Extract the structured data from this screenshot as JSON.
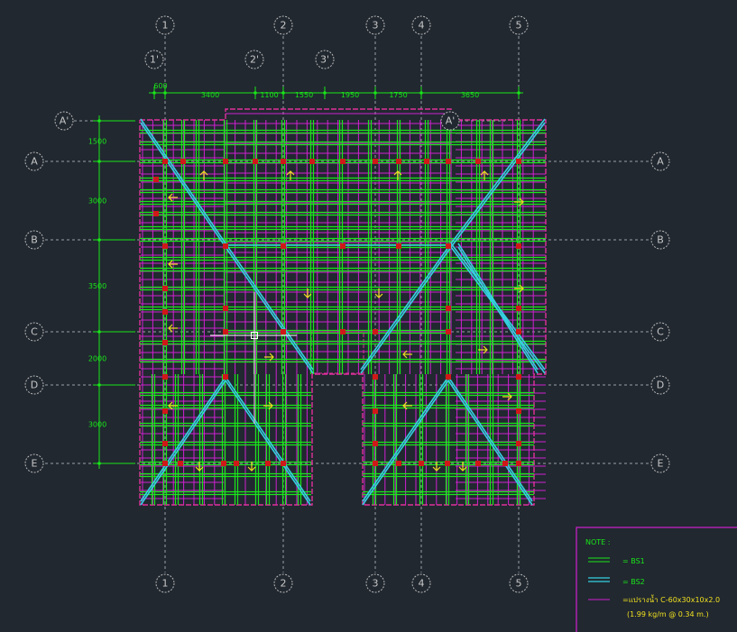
{
  "grid": {
    "columns_main": [
      "1",
      "2",
      "3",
      "4",
      "5"
    ],
    "columns_sub": [
      "1'",
      "2'",
      "3'"
    ],
    "rows": [
      "A",
      "B",
      "C",
      "D",
      "E"
    ],
    "row_sub": "A'"
  },
  "dimensions": {
    "horizontal": [
      "600",
      "3400",
      "1100",
      "1550",
      "1950",
      "1750",
      "3650"
    ],
    "vertical": [
      "1500",
      "3000",
      "3500",
      "2000",
      "3000"
    ]
  },
  "legend": {
    "title": "NOTE :",
    "bs1": "= BS1",
    "bs2": "= BS2",
    "purlin": "=แปรางน้ำ  C-60x30x10x2.0",
    "purlin_detail": "(1.99 kg/m @ 0.34 m.)"
  },
  "colors": {
    "background": "#212830",
    "bs1": "#19e619",
    "bs2": "#35d0e0",
    "purlin": "#d020d0",
    "column_point": "#d01818",
    "arrow": "#f0e020",
    "gridline": "#9aa0a6"
  }
}
